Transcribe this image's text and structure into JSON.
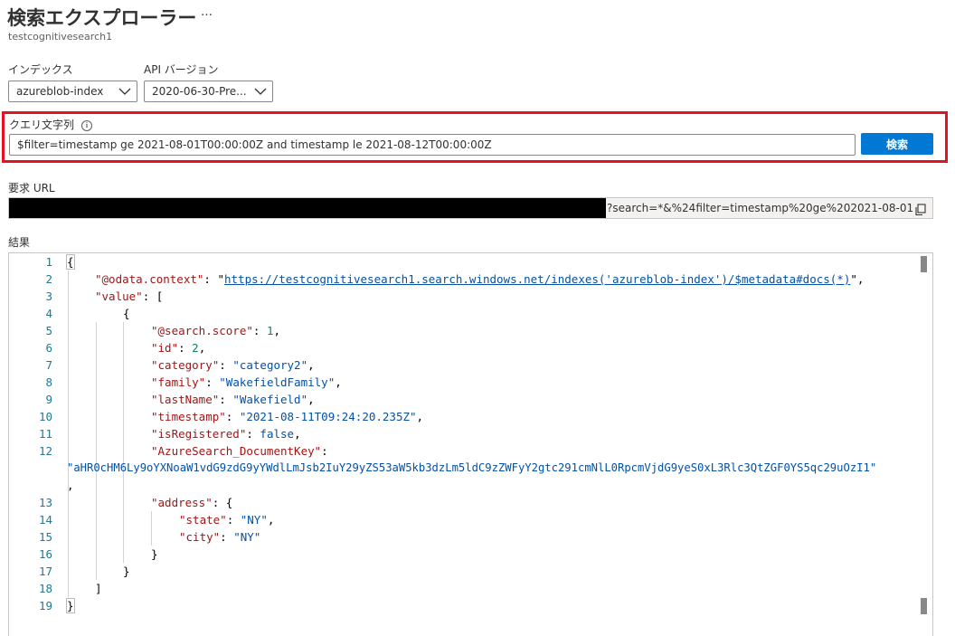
{
  "header": {
    "title": "検索エクスプローラー",
    "more": "…",
    "subtitle": "testcognitivesearch1"
  },
  "index": {
    "label": "インデックス",
    "value": "azureblob-index"
  },
  "api_version": {
    "label": "API バージョン",
    "value": "2020-06-30-Pre..."
  },
  "query": {
    "label": "クエリ文字列",
    "value": "$filter=timestamp ge 2021-08-01T00:00:00Z and timestamp le 2021-08-12T00:00:00Z",
    "search_button": "検索"
  },
  "request_url": {
    "label": "要求 URL",
    "visible_text": "?search=*&%24filter=timestamp%20ge%202021-08-01T..."
  },
  "results": {
    "label": "結果",
    "line_numbers": [
      "1",
      "2",
      "3",
      "4",
      "5",
      "6",
      "7",
      "8",
      "9",
      "10",
      "11",
      "12",
      "13",
      "14",
      "15",
      "16",
      "17",
      "18",
      "19"
    ],
    "odata_context_key": "\"@odata.context\"",
    "odata_context_value": "https://testcognitivesearch1.search.windows.net/indexes('azureblob-index')/$metadata#docs(*)",
    "value_key": "\"value\"",
    "score_key": "\"@search.score\"",
    "score_value": "1",
    "id_key": "\"id\"",
    "id_value": "2",
    "category_key": "\"category\"",
    "category_value": "\"category2\"",
    "family_key": "\"family\"",
    "family_value": "\"WakefieldFamily\"",
    "lastname_key": "\"lastName\"",
    "lastname_value": "\"Wakefield\"",
    "timestamp_key": "\"timestamp\"",
    "timestamp_value": "\"2021-08-11T09:24:20.235Z\"",
    "isregistered_key": "\"isRegistered\"",
    "isregistered_value": "false",
    "dockey_key": "\"AzureSearch_DocumentKey\"",
    "dockey_value": "\"aHR0cHM6Ly9oYXNoaW1vdG9zdG9yYWdlLmJsb2IuY29yZS53aW5kb3dzLm5ldC9zZWFyY2gtc291cmNlL0RpcmVjdG9yeS0xL3Rlc3QtZGF0YS5qc29uOzI1\"",
    "address_key": "\"address\"",
    "state_key": "\"state\"",
    "state_value": "\"NY\"",
    "city_key": "\"city\"",
    "city_value": "\"NY\""
  },
  "colors": {
    "primary": "#0078d4",
    "highlight_border": "#e81123",
    "json_key": "#a31515",
    "json_string": "#0451a5",
    "json_number": "#098658",
    "line_number": "#237893"
  }
}
